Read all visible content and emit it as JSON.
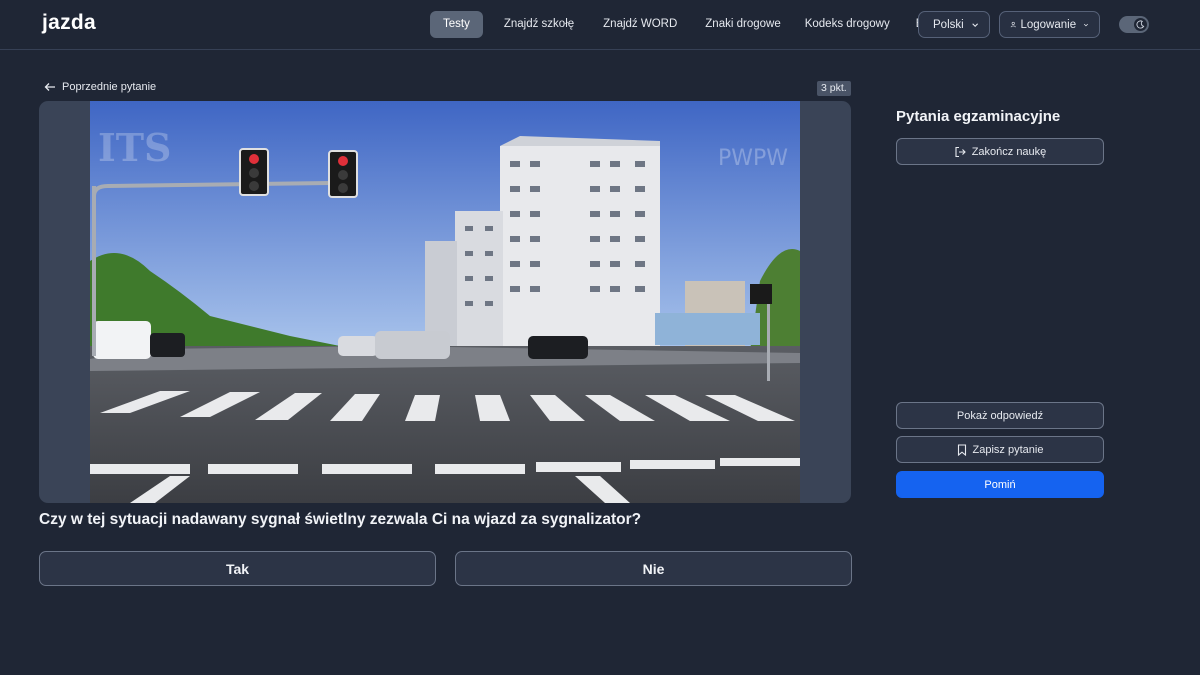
{
  "header": {
    "logo": "jazda",
    "nav": [
      {
        "label": "Testy",
        "active": true
      },
      {
        "label": "Znajdź szkołę"
      },
      {
        "label": "Znajdź WORD"
      },
      {
        "label": "Znaki drogowe"
      },
      {
        "label": "Kodeks drogowy"
      },
      {
        "label": "Blog"
      }
    ],
    "language": "Polski",
    "login": "Logowanie"
  },
  "question": {
    "prev_label": "Poprzednie pytanie",
    "points": "3 pkt.",
    "text": "Czy w tej sytuacji nadawany sygnał świetlny zezwala Ci na wjazd za sygnalizator?",
    "answers": [
      "Tak",
      "Nie"
    ],
    "watermarks": [
      "ITS",
      "PWPW"
    ]
  },
  "sidebar": {
    "title": "Pytania egzaminacyjne",
    "end_label": "Zakończ naukę",
    "show_label": "Pokaż odpowiedź",
    "save_label": "Zapisz pytanie",
    "skip_label": "Pomiń"
  },
  "colors": {
    "background": "#1f2635",
    "accent": "#1563f0",
    "active_nav": "#5b6678"
  }
}
